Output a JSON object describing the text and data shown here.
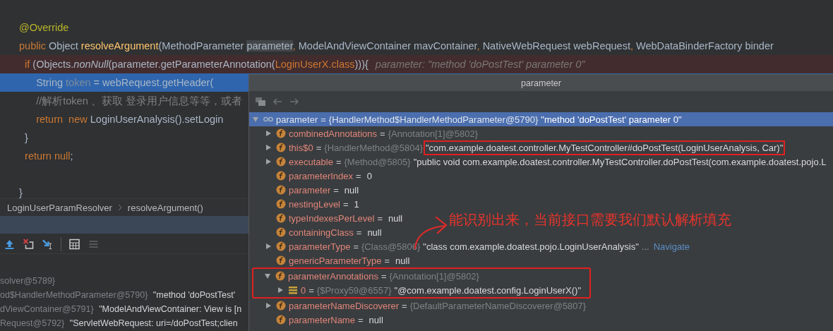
{
  "editor": {
    "lines": [
      {
        "kind": "code",
        "tokens": [
          {
            "kind": "annotation",
            "text": "@Override"
          }
        ]
      },
      {
        "kind": "code",
        "tokens": [
          {
            "kind": "keyword",
            "text": "public "
          },
          {
            "kind": "plain",
            "text": "Object "
          },
          {
            "kind": "method",
            "text": "resolveArgument"
          },
          {
            "kind": "plain",
            "text": "(MethodParameter "
          },
          {
            "kind": "usage",
            "text": "parameter"
          },
          {
            "kind": "keyword",
            "text": ", "
          },
          {
            "kind": "plain",
            "text": "ModelAndViewContainer mavContainer"
          },
          {
            "kind": "keyword",
            "text": ", "
          },
          {
            "kind": "plain",
            "text": "NativeWebRequest webRequest"
          },
          {
            "kind": "keyword",
            "text": ", "
          },
          {
            "kind": "plain",
            "text": "WebDataBinderFactory binder"
          }
        ]
      },
      {
        "kind": "breakpoint",
        "tokens": [
          {
            "kind": "keyword",
            "text": "  if "
          },
          {
            "kind": "plain",
            "text": "(Objects."
          },
          {
            "kind": "italic",
            "text": "nonNull"
          },
          {
            "kind": "plain",
            "text": "(parameter.getParameterAnnotation("
          },
          {
            "kind": "keyword",
            "text": "LoginUserX.class"
          },
          {
            "kind": "plain",
            "text": "))){"
          },
          {
            "kind": "hint",
            "text": "parameter: \"method 'doPostTest' parameter 0\""
          }
        ]
      },
      {
        "kind": "execution",
        "tokens": [
          {
            "kind": "plain",
            "text": "      String "
          },
          {
            "kind": "unused",
            "text": "token"
          },
          {
            "kind": "plain",
            "text": " = webRequest.getHeader("
          }
        ]
      },
      {
        "kind": "code",
        "tokens": [
          {
            "kind": "comment",
            "text": "      //解析token 、获取 登录用户信息等等，或者"
          }
        ]
      },
      {
        "kind": "code",
        "tokens": [
          {
            "kind": "keyword",
            "text": "      return  new "
          },
          {
            "kind": "plain",
            "text": "LoginUserAnalysis().setLogin"
          }
        ]
      },
      {
        "kind": "code",
        "tokens": [
          {
            "kind": "plain",
            "text": "  }"
          }
        ]
      },
      {
        "kind": "code",
        "tokens": [
          {
            "kind": "keyword",
            "text": "  return null"
          },
          {
            "kind": "plain",
            "text": ";"
          }
        ]
      },
      {
        "kind": "blank"
      },
      {
        "kind": "code",
        "tokens": [
          {
            "kind": "plain",
            "text": "}"
          }
        ]
      }
    ]
  },
  "breadcrumb": [
    "LoginUserParamResolver",
    "resolveArgument()"
  ],
  "variables": [
    {
      "ref": "solver@5789}"
    },
    {
      "ref": "od$HandlerMethodParameter@5790}",
      "value": "\"method 'doPostTest'"
    },
    {
      "ref": "dViewContainer@5791}",
      "value": "\"ModelAndViewContainer: View is [n"
    },
    {
      "ref": "Request@5792}",
      "value": "\"ServletWebRequest: uri=/doPostTest;clien"
    }
  ],
  "popup": {
    "title": "parameter",
    "tree": {
      "kind": "watch",
      "name": "parameter",
      "operator": "=",
      "ref": "{HandlerMethod$HandlerMethodParameter@5790}",
      "value": "\"method 'doPostTest' parameter 0\"",
      "expandable": true,
      "expanded": true,
      "selected": true,
      "children": [
        {
          "kind": "field",
          "name": "combinedAnnotations",
          "operator": "=",
          "ref": "{Annotation[1]@5802}",
          "expandable": true,
          "expanded": false,
          "selected": false
        },
        {
          "kind": "field",
          "name": "this$0",
          "operator": "=",
          "ref": "{HandlerMethod@5804}",
          "value": "\"com.example.doatest.controller.MyTestController#doPostTest(LoginUserAnalysis, Car)\"",
          "expandable": true,
          "expanded": false,
          "selected": false,
          "boxed": true
        },
        {
          "kind": "field",
          "name": "executable",
          "operator": "=",
          "ref": "{Method@5805}",
          "value": "\"public void com.example.doatest.controller.MyTestController.doPostTest(com.example.doatest.pojo.L",
          "expandable": true,
          "expanded": false,
          "selected": false
        },
        {
          "kind": "field",
          "name": "parameterIndex",
          "operator": "=",
          "value": "0",
          "expandable": false,
          "selected": false
        },
        {
          "kind": "field",
          "name": "parameter",
          "operator": "=",
          "value": "null",
          "expandable": false,
          "selected": false
        },
        {
          "kind": "field",
          "name": "nestingLevel",
          "operator": "=",
          "value": "1",
          "expandable": false,
          "selected": false
        },
        {
          "kind": "field",
          "name": "typeIndexesPerLevel",
          "operator": "=",
          "value": "null",
          "expandable": false,
          "selected": false
        },
        {
          "kind": "field",
          "name": "containingClass",
          "operator": "=",
          "value": "null",
          "expandable": false,
          "selected": false
        },
        {
          "kind": "field",
          "name": "parameterType",
          "operator": "=",
          "ref": "{Class@5806}",
          "value": "\"class com.example.doatest.pojo.LoginUserAnalysis\"",
          "ellipsis": "...",
          "link": "Navigate",
          "expandable": true,
          "expanded": false,
          "selected": false
        },
        {
          "kind": "field",
          "name": "genericParameterType",
          "operator": "=",
          "value": "null",
          "expandable": false,
          "selected": false
        },
        {
          "kind": "field",
          "name": "parameterAnnotations",
          "operator": "=",
          "ref": "{Annotation[1]@5802}",
          "expandable": true,
          "expanded": true,
          "selected": false,
          "boxed": true,
          "children": [
            {
              "kind": "element",
              "name": "0",
              "operator": "=",
              "ref": "{$Proxy59@6557}",
              "value": "\"@com.example.doatest.config.LoginUserX()\"",
              "expandable": true,
              "expanded": false,
              "selected": false
            }
          ]
        },
        {
          "kind": "field",
          "name": "parameterNameDiscoverer",
          "operator": "=",
          "ref": "{DefaultParameterNameDiscoverer@5807}",
          "expandable": true,
          "expanded": false,
          "selected": false
        },
        {
          "kind": "field",
          "name": "parameterName",
          "operator": "=",
          "value": "null",
          "expandable": false,
          "selected": false
        }
      ]
    }
  },
  "annotation": {
    "text": "能识别出来，当前接口需要我们默认解析填充"
  }
}
